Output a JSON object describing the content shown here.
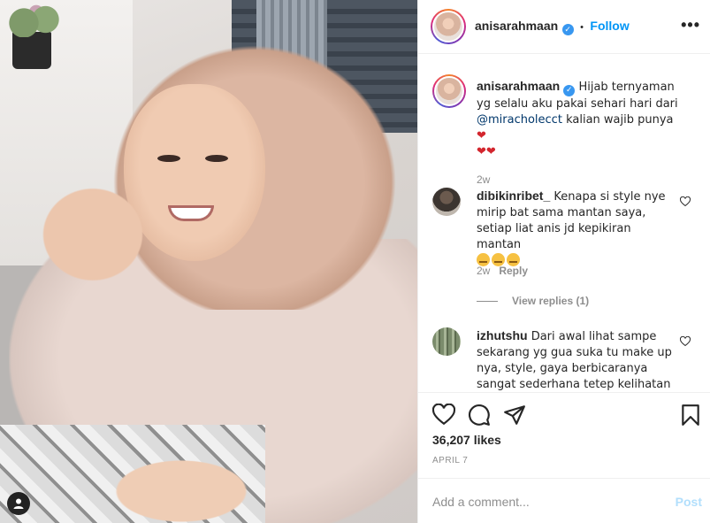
{
  "post": {
    "username": "anisarahmaan",
    "follow_label": "Follow",
    "dot_separator": "•",
    "more_icon": "more-dots-icon",
    "caption_start": "Hijab ternyaman yg selalu aku pakai sehari hari dari",
    "caption_mention": "@miracholecct",
    "caption_end": "kalian wajib punya",
    "caption_age": "2w"
  },
  "comments": [
    {
      "username": "dibikinribet_",
      "text": "Kenapa si style nye mirip bat sama mantan saya, setiap liat anis jd kepikiran mantan",
      "age": "2w",
      "reply_label": "Reply",
      "view_replies": "View replies (1)"
    },
    {
      "username": "izhutshu",
      "text": "Dari awal lihat sampe sekarang yg gua suka tu make up nya, style, gaya berbicaranya sangat sederhana tetep kelihatan"
    }
  ],
  "stats": {
    "likes": "36,207 likes",
    "date": "APRIL 7"
  },
  "add_comment": {
    "placeholder": "Add a comment...",
    "post_label": "Post"
  },
  "colors": {
    "link_blue": "#0095f6",
    "verified_blue": "#3897f0",
    "heart_red": "#ed4956",
    "meta_gray": "#8e8e8e"
  }
}
